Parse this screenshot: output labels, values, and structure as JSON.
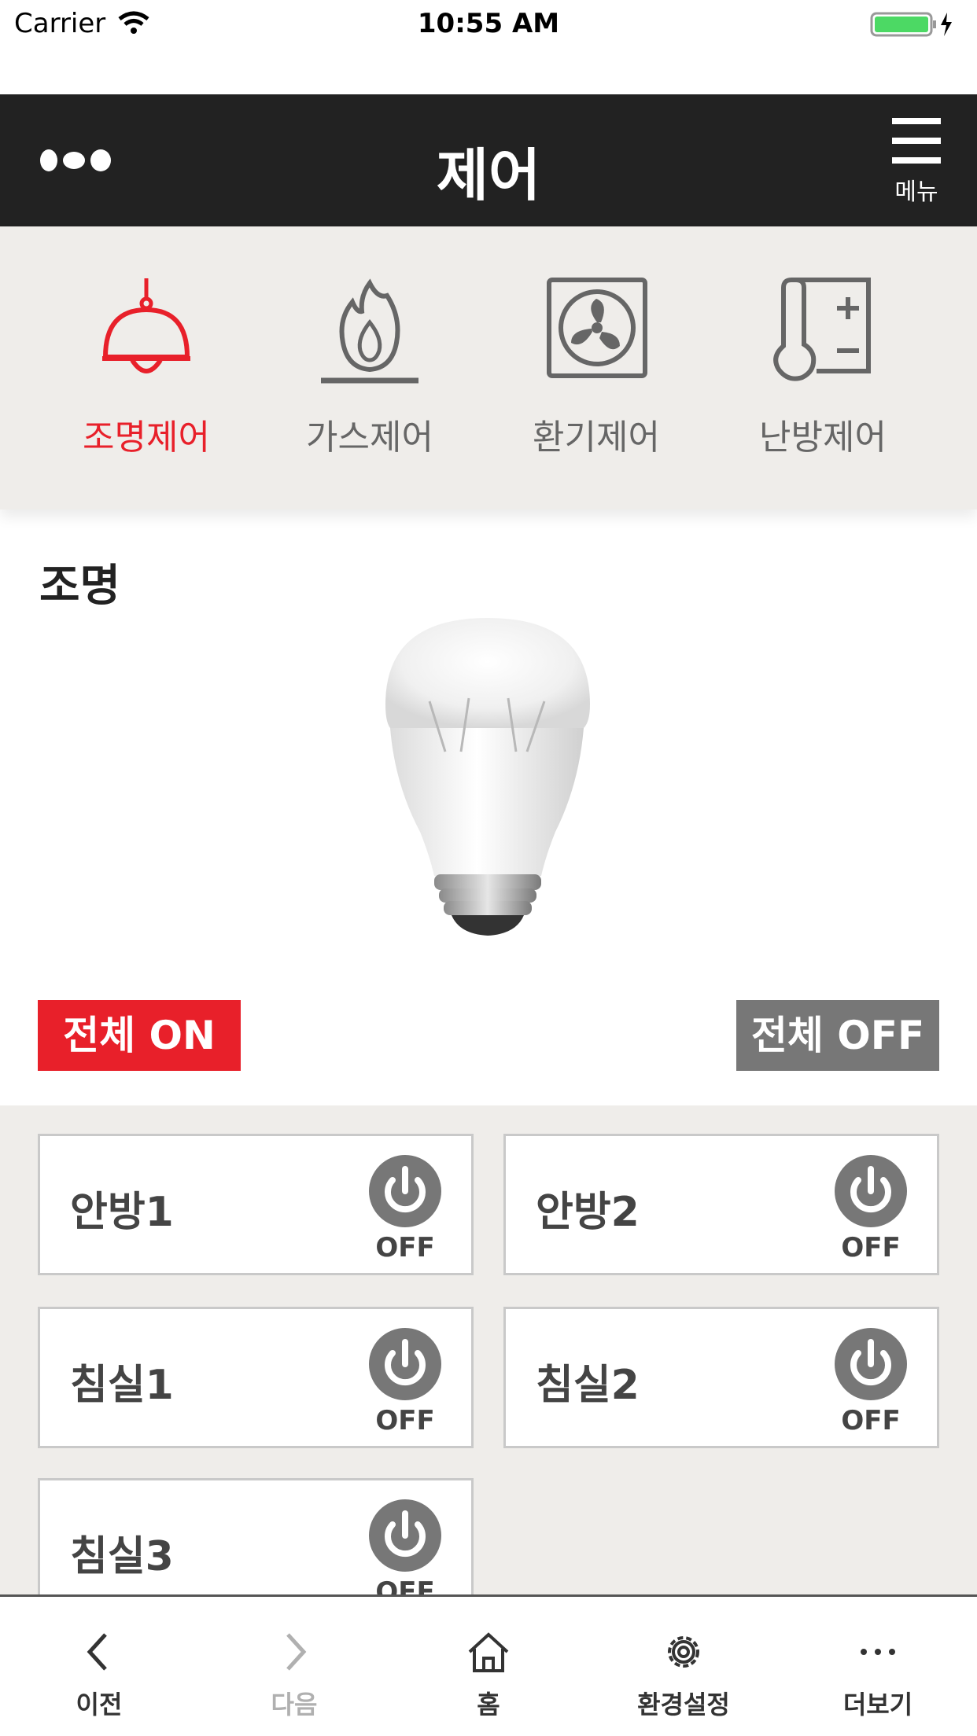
{
  "status_bar": {
    "carrier": "Carrier",
    "time": "10:55 AM"
  },
  "header": {
    "title": "제어",
    "menu_label": "메뉴"
  },
  "tabs": [
    {
      "label": "조명제어",
      "icon": "lamp-icon",
      "active": true
    },
    {
      "label": "가스제어",
      "icon": "gas-flame-icon",
      "active": false
    },
    {
      "label": "환기제어",
      "icon": "fan-icon",
      "active": false
    },
    {
      "label": "난방제어",
      "icon": "thermometer-icon",
      "active": false
    }
  ],
  "section": {
    "title": "조명"
  },
  "actions": {
    "all_on": "전체 ON",
    "all_off": "전체 OFF"
  },
  "rooms": [
    {
      "name": "안방1",
      "state": "OFF"
    },
    {
      "name": "안방2",
      "state": "OFF"
    },
    {
      "name": "침실1",
      "state": "OFF"
    },
    {
      "name": "침실2",
      "state": "OFF"
    },
    {
      "name": "침실3",
      "state": "OFF"
    }
  ],
  "bottom_nav": [
    {
      "label": "이전",
      "icon": "chevron-left-icon",
      "enabled": true
    },
    {
      "label": "다음",
      "icon": "chevron-right-icon",
      "enabled": false
    },
    {
      "label": "홈",
      "icon": "home-icon",
      "enabled": true
    },
    {
      "label": "환경설정",
      "icon": "gear-icon",
      "enabled": true
    },
    {
      "label": "더보기",
      "icon": "more-icon",
      "enabled": true
    }
  ],
  "colors": {
    "accent": "#e8202a",
    "header_bg": "#222222",
    "panel_bg": "#efedea",
    "off_button": "#777777",
    "inactive_icon": "#666666"
  }
}
